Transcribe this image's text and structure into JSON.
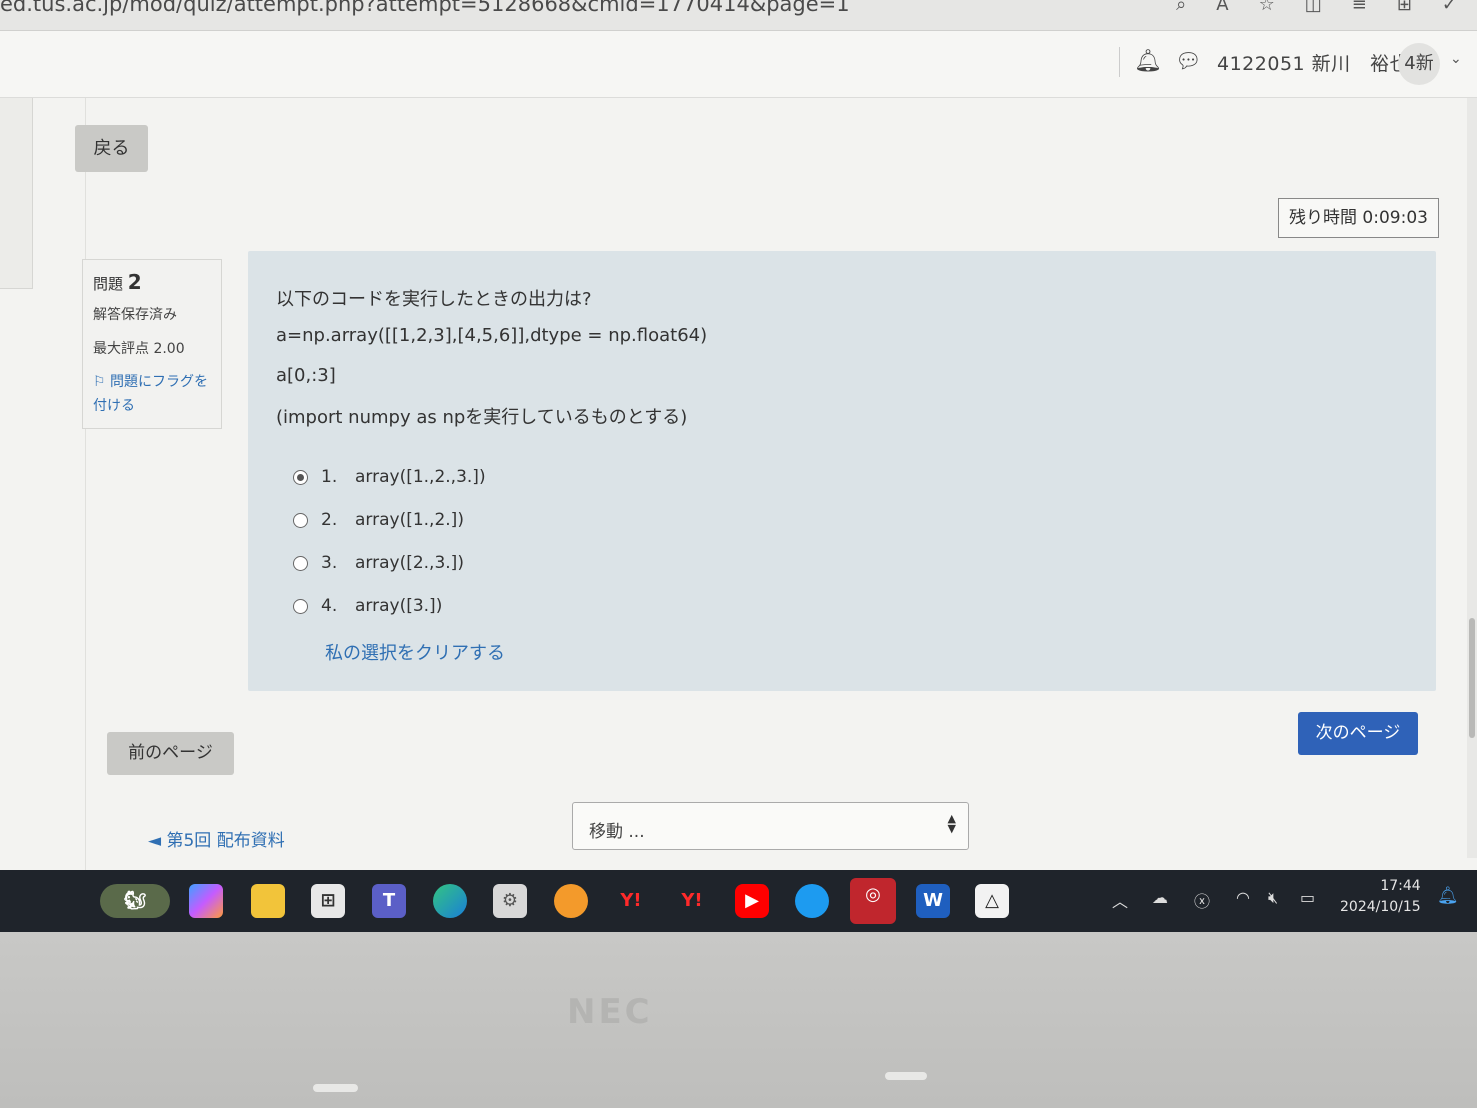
{
  "browser": {
    "url": "ed.tus.ac.jp/mod/quiz/attempt.php?attempt=5128668&cmid=1770414&page=1",
    "icons": [
      "search-icon",
      "read-aloud-icon",
      "favorite-star-icon",
      "split-screen-icon",
      "favorites-list-icon",
      "collections-icon",
      "extensions-icon"
    ]
  },
  "topnav": {
    "user_name": "4122051 新川　裕也",
    "avatar_text": "4新",
    "icons": [
      "bell-icon",
      "chat-icon",
      "chevron-down-icon"
    ]
  },
  "page": {
    "back_label": "戻る",
    "timer": "残り時間 0:09:03"
  },
  "question_info": {
    "label": "問題",
    "number": "2",
    "state": "解答保存済み",
    "max_mark": "最大評点 2.00",
    "flag_label": "問題にフラグを付ける"
  },
  "question": {
    "line1": "以下のコードを実行したときの出力は?",
    "line2": "a=np.array([[1,2,3],[4,5,6]],dtype = np.float64)",
    "line3": "a[0,:3]",
    "line4": "(import numpy as npを実行しているものとする)",
    "options": [
      {
        "num": "1.",
        "text": "array([1.,2.,3.])",
        "selected": true
      },
      {
        "num": "2.",
        "text": "array([1.,2.])",
        "selected": false
      },
      {
        "num": "3.",
        "text": "array([2.,3.])",
        "selected": false
      },
      {
        "num": "4.",
        "text": "array([3.])",
        "selected": false
      }
    ],
    "clear_label": "私の選択をクリアする"
  },
  "navigation": {
    "prev_page": "前のページ",
    "next_page": "次のページ",
    "prev_activity": "◄ 第5回 配布資料",
    "jump_placeholder": "移動 ..."
  },
  "taskbar": {
    "apps": [
      "widgets-icon",
      "copilot-icon",
      "file-explorer-icon",
      "microsoft-store-icon",
      "teams-icon",
      "edge-icon",
      "settings-icon",
      "browser-app-icon",
      "yahoo-icon",
      "yahoo-icon",
      "youtube-icon",
      "twitter-icon",
      "trend-micro-icon",
      "word-icon",
      "app-icon"
    ],
    "time": "17:44",
    "date": "2024/10/15"
  },
  "colors": {
    "link": "#2f6fb3",
    "primary_button": "#2f62b8",
    "question_bg": "#dbe3e7"
  }
}
